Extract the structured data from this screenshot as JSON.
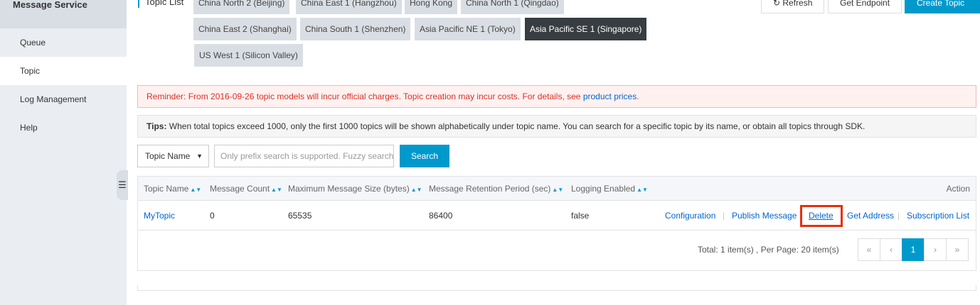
{
  "sidebar": {
    "title": "Message Service",
    "items": [
      {
        "label": "Queue"
      },
      {
        "label": "Topic"
      },
      {
        "label": "Log Management"
      },
      {
        "label": "Help"
      }
    ],
    "collapse_icon": "list-icon"
  },
  "header": {
    "topic_list_label": "Topic List",
    "regions": [
      "China North 2 (Beijing)",
      "China East 1 (Hangzhou)",
      "Hong Kong",
      "China North 1 (Qingdao)",
      "China East 2 (Shanghai)",
      "China South 1 (Shenzhen)",
      "Asia Pacific NE 1 (Tokyo)",
      "Asia Pacific SE 1 (Singapore)",
      "US West 1 (Silicon Valley)"
    ],
    "active_region": "Asia Pacific SE 1 (Singapore)",
    "refresh_label": "Refresh",
    "get_endpoint_label": "Get Endpoint",
    "create_topic_label": "Create Topic"
  },
  "reminder": {
    "text": "Reminder: From 2016-09-26 topic models will incur official charges. Topic creation may incur costs. For details, see ",
    "link": "product prices",
    "suffix": "."
  },
  "tips": {
    "label": "Tips:",
    "text": " When total topics exceed 1000, only the first 1000 topics will be shown alphabetically under topic name. You can search for a specific topic by its name, or obtain all topics through SDK."
  },
  "search": {
    "select_value": "Topic Name",
    "placeholder": "Only prefix search is supported. Fuzzy search",
    "button_label": "Search"
  },
  "table": {
    "columns": {
      "topic_name": "Topic Name",
      "message_count": "Message Count",
      "max_size": "Maximum Message Size (bytes)",
      "retention": "Message Retention Period (sec)",
      "logging": "Logging Enabled",
      "action": "Action"
    },
    "rows": [
      {
        "topic_name": "MyTopic",
        "message_count": "0",
        "max_size": "65535",
        "retention": "86400",
        "logging": "false",
        "actions": {
          "configuration": "Configuration",
          "publish": "Publish Message",
          "delete": "Delete",
          "get_address": "Get Address",
          "subscription_list": "Subscription List"
        }
      }
    ]
  },
  "pagination": {
    "total_text": "Total: 1 item(s) ,  Per Page: 20 item(s)",
    "first": "«",
    "prev": "‹",
    "current": "1",
    "next": "›",
    "last": "»"
  },
  "colors": {
    "accent": "#0099cc",
    "active_region": "#373d41",
    "highlight": "#e52f0c"
  }
}
